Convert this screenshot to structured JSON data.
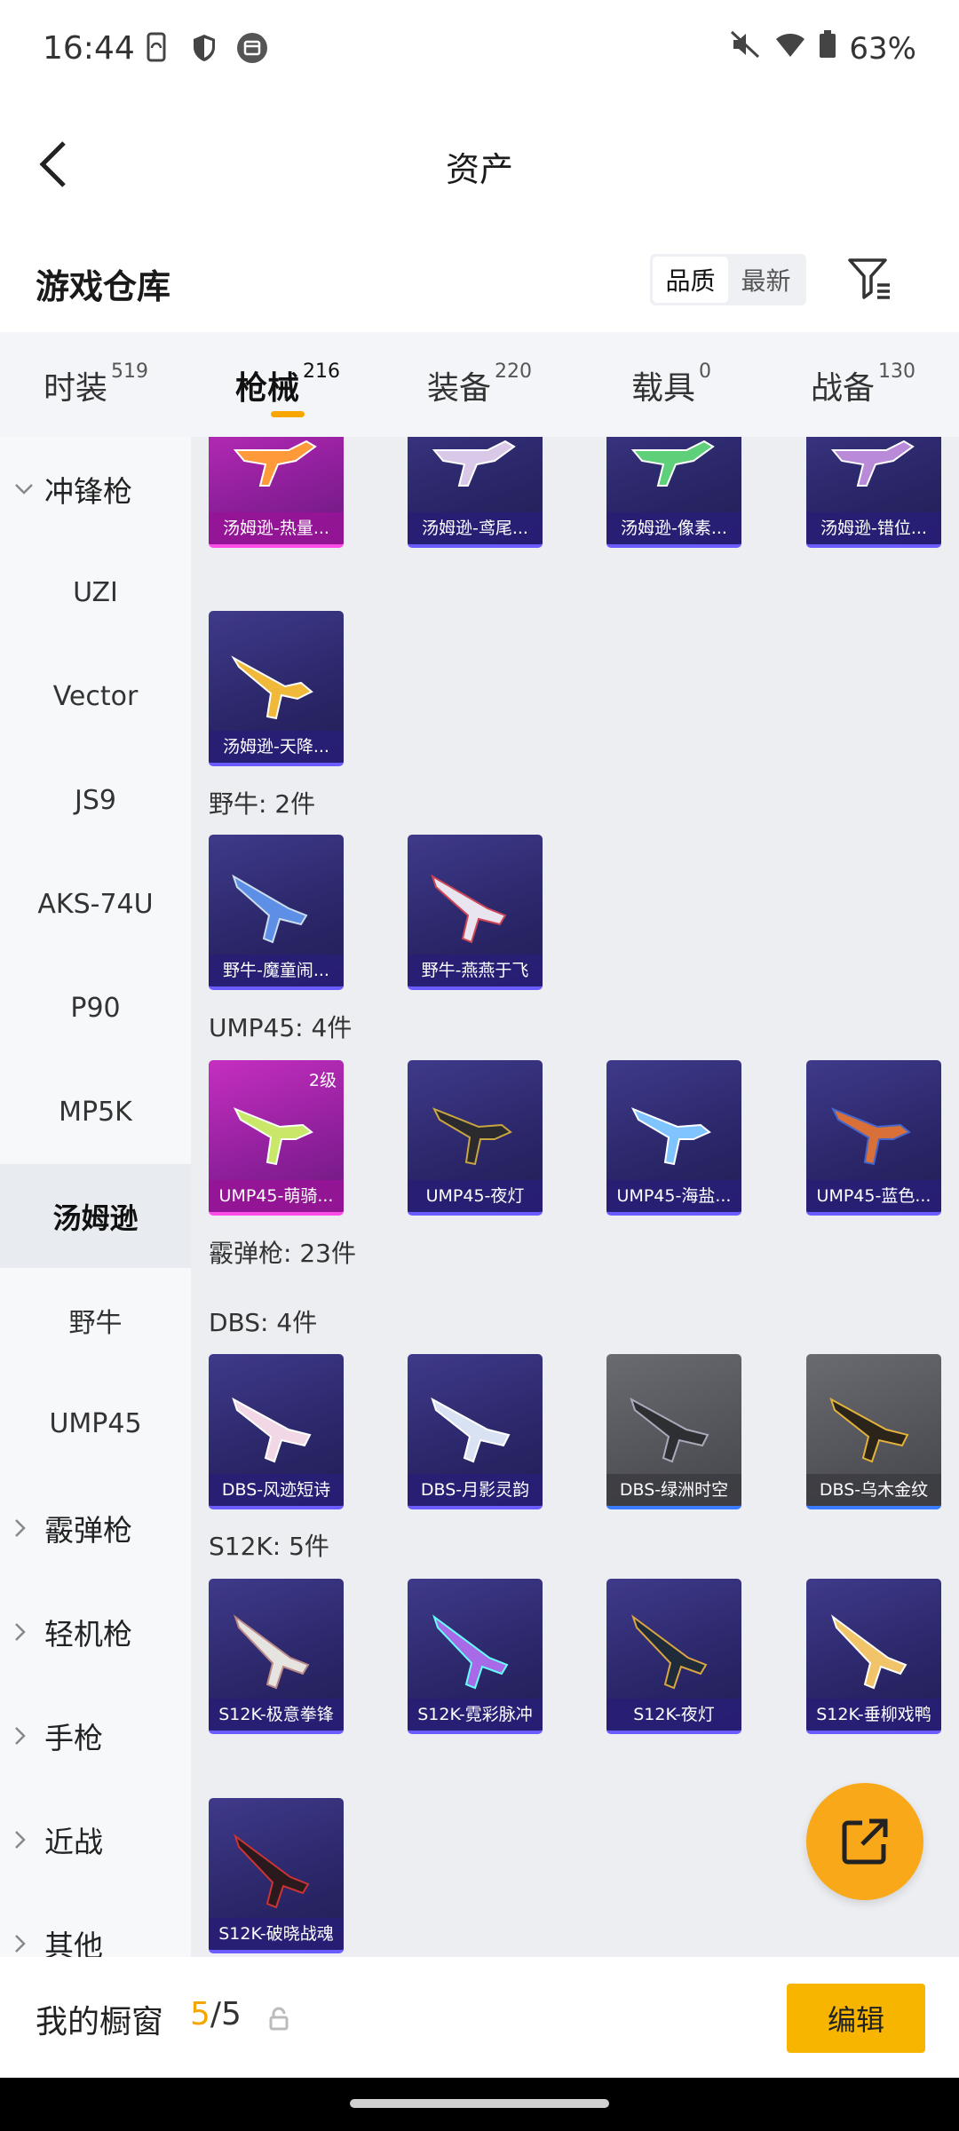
{
  "status_bar": {
    "time": "16:44",
    "battery": "63%"
  },
  "header": {
    "title": "资产"
  },
  "toolbar": {
    "title": "游戏仓库",
    "sort_quality": "品质",
    "sort_latest": "最新"
  },
  "tabs": [
    {
      "label": "时装",
      "count": "519"
    },
    {
      "label": "枪械",
      "count": "216"
    },
    {
      "label": "装备",
      "count": "220"
    },
    {
      "label": "载具",
      "count": "0"
    },
    {
      "label": "战备",
      "count": "130"
    }
  ],
  "sidebar": {
    "items": [
      {
        "label": "冲锋枪",
        "kind": "group-open"
      },
      {
        "label": "UZI"
      },
      {
        "label": "Vector"
      },
      {
        "label": "JS9"
      },
      {
        "label": "AKS-74U"
      },
      {
        "label": "P90"
      },
      {
        "label": "MP5K"
      },
      {
        "label": "汤姆逊",
        "active": true
      },
      {
        "label": "野牛"
      },
      {
        "label": "UMP45"
      },
      {
        "label": "霰弹枪",
        "kind": "group"
      },
      {
        "label": "轻机枪",
        "kind": "group"
      },
      {
        "label": "手枪",
        "kind": "group"
      },
      {
        "label": "近战",
        "kind": "group"
      },
      {
        "label": "其他",
        "kind": "group"
      }
    ]
  },
  "sections": {
    "bison": "野牛: 2件",
    "ump": "UMP45: 4件",
    "shotgun": "霰弹枪: 23件",
    "dbs": "DBS: 4件",
    "s12k": "S12K: 5件"
  },
  "cards": {
    "thompson": [
      "汤姆逊-热量...",
      "汤姆逊-鸢尾...",
      "汤姆逊-像素...",
      "汤姆逊-错位...",
      "汤姆逊-天降..."
    ],
    "bison": [
      "野牛-魔童闹...",
      "野牛-燕燕于飞"
    ],
    "ump": [
      "UMP45-萌骑...",
      "UMP45-夜灯",
      "UMP45-海盐...",
      "UMP45-蓝色..."
    ],
    "ump_level": "2级",
    "dbs": [
      "DBS-风迹短诗",
      "DBS-月影灵韵",
      "DBS-绿洲时空",
      "DBS-乌木金纹"
    ],
    "s12k": [
      "S12K-极意拳锋",
      "S12K-霓彩脉冲",
      "S12K-夜灯",
      "S12K-垂柳戏鸭",
      "S12K-破晓战魂"
    ]
  },
  "bottom_bar": {
    "title": "我的橱窗",
    "current": "5",
    "total": "/5",
    "edit": "编辑"
  },
  "colors": {
    "accent": "#f7a600",
    "fab": "#f9a81a",
    "epic": "#2a2668",
    "legend": "#8e1f9b"
  }
}
